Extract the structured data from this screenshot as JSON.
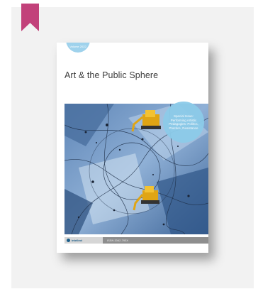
{
  "bookmark": {
    "color": "#c2417a"
  },
  "cover": {
    "badge": "Volume\n2022",
    "title": "Art & the Public Sphere",
    "bubble": "Special Issue: Performing Artistic Pedagogies: Politics, Practice, Resistance",
    "publisher": "intellect",
    "issn": "ISSN 2042-793X"
  }
}
